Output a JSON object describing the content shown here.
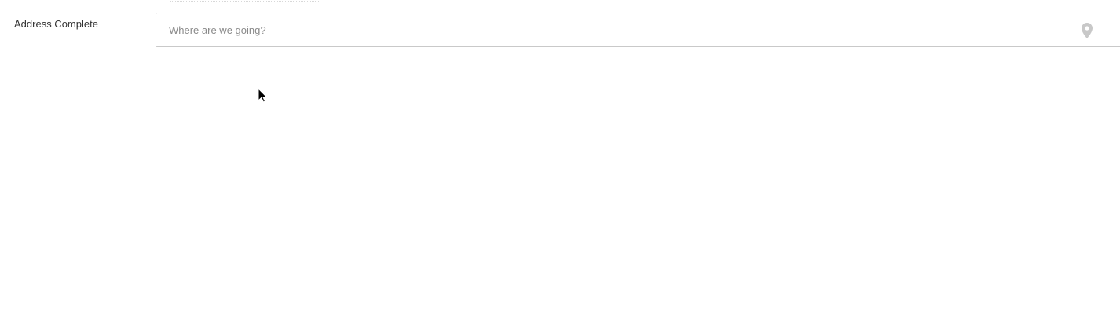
{
  "form": {
    "address_field": {
      "label": "Address Complete",
      "placeholder": "Where are we going?",
      "value": ""
    }
  },
  "icons": {
    "location": "map-pin-icon",
    "pointer": "mouse-cursor-icon"
  },
  "colors": {
    "label_text": "#333333",
    "placeholder_text": "#8a8a8a",
    "input_border": "#c9c9c9",
    "icon_fill": "#c8c8c8",
    "background": "#ffffff"
  }
}
